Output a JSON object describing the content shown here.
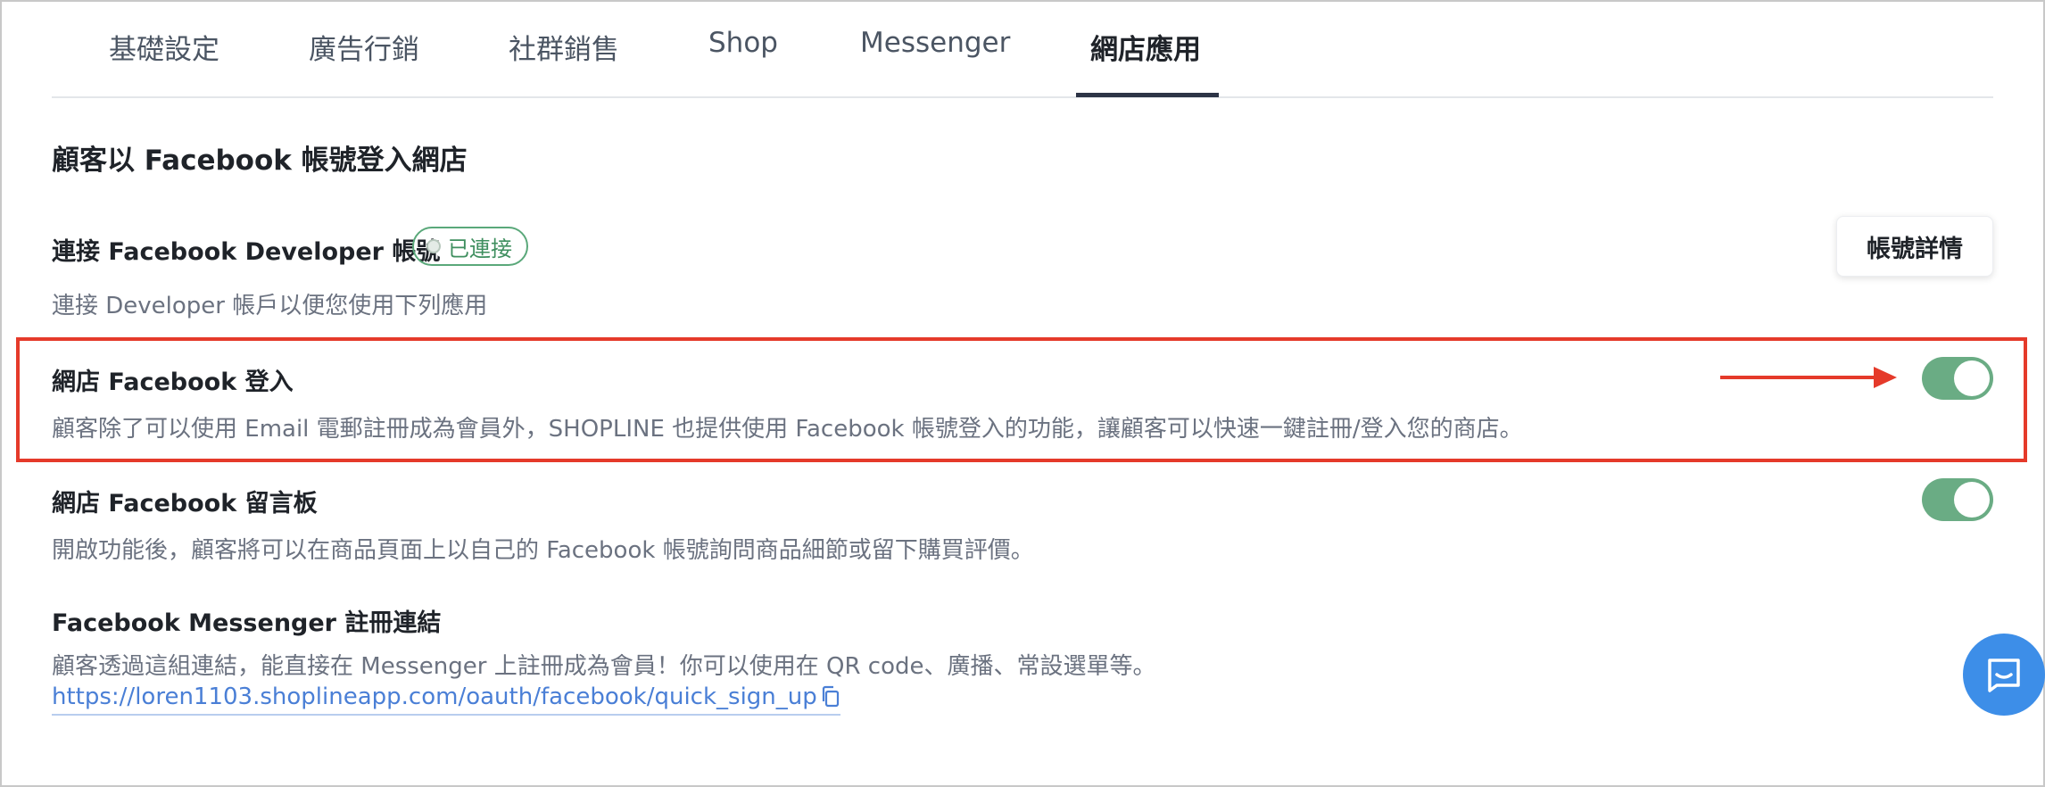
{
  "tabs": [
    {
      "label": "基礎設定",
      "active": false
    },
    {
      "label": "廣告行銷",
      "active": false
    },
    {
      "label": "社群銷售",
      "active": false
    },
    {
      "label": "Shop",
      "active": false
    },
    {
      "label": "Messenger",
      "active": false
    },
    {
      "label": "網店應用",
      "active": true
    }
  ],
  "section": {
    "title": "顧客以 Facebook 帳號登入網店"
  },
  "developer": {
    "title": "連接 Facebook Developer 帳號",
    "badge": "已連接",
    "description": "連接 Developer 帳戶以便您使用下列應用",
    "details_button": "帳號詳情"
  },
  "facebook_login": {
    "title": "網店 Facebook 登入",
    "description": "顧客除了可以使用 Email 電郵註冊成為會員外，SHOPLINE 也提供使用 Facebook 帳號登入的功能，讓顧客可以快速一鍵註冊/登入您的商店。",
    "enabled": true
  },
  "facebook_comments": {
    "title": "網店 Facebook 留言板",
    "description": "開啟功能後，顧客將可以在商品頁面上以自己的 Facebook 帳號詢問商品細節或留下購買評價。",
    "enabled": true
  },
  "messenger_signup": {
    "title": "Facebook Messenger 註冊連結",
    "description": "顧客透過這組連結，能直接在 Messenger 上註冊成為會員！你可以使用在 QR code、廣播、常設選單等。",
    "link": "https://loren1103.shoplineapp.com/oauth/facebook/quick_sign_up"
  },
  "icons": {
    "copy": "copy-icon",
    "arrow": "arrow-right-icon",
    "chat": "chat-icon"
  },
  "colors": {
    "toggle_on": "#6aac84",
    "badge_green": "#3f8f5f",
    "highlight_red": "#e53a2a",
    "link_blue": "#4a7fd6",
    "chat_blue": "#3d8ee8"
  }
}
